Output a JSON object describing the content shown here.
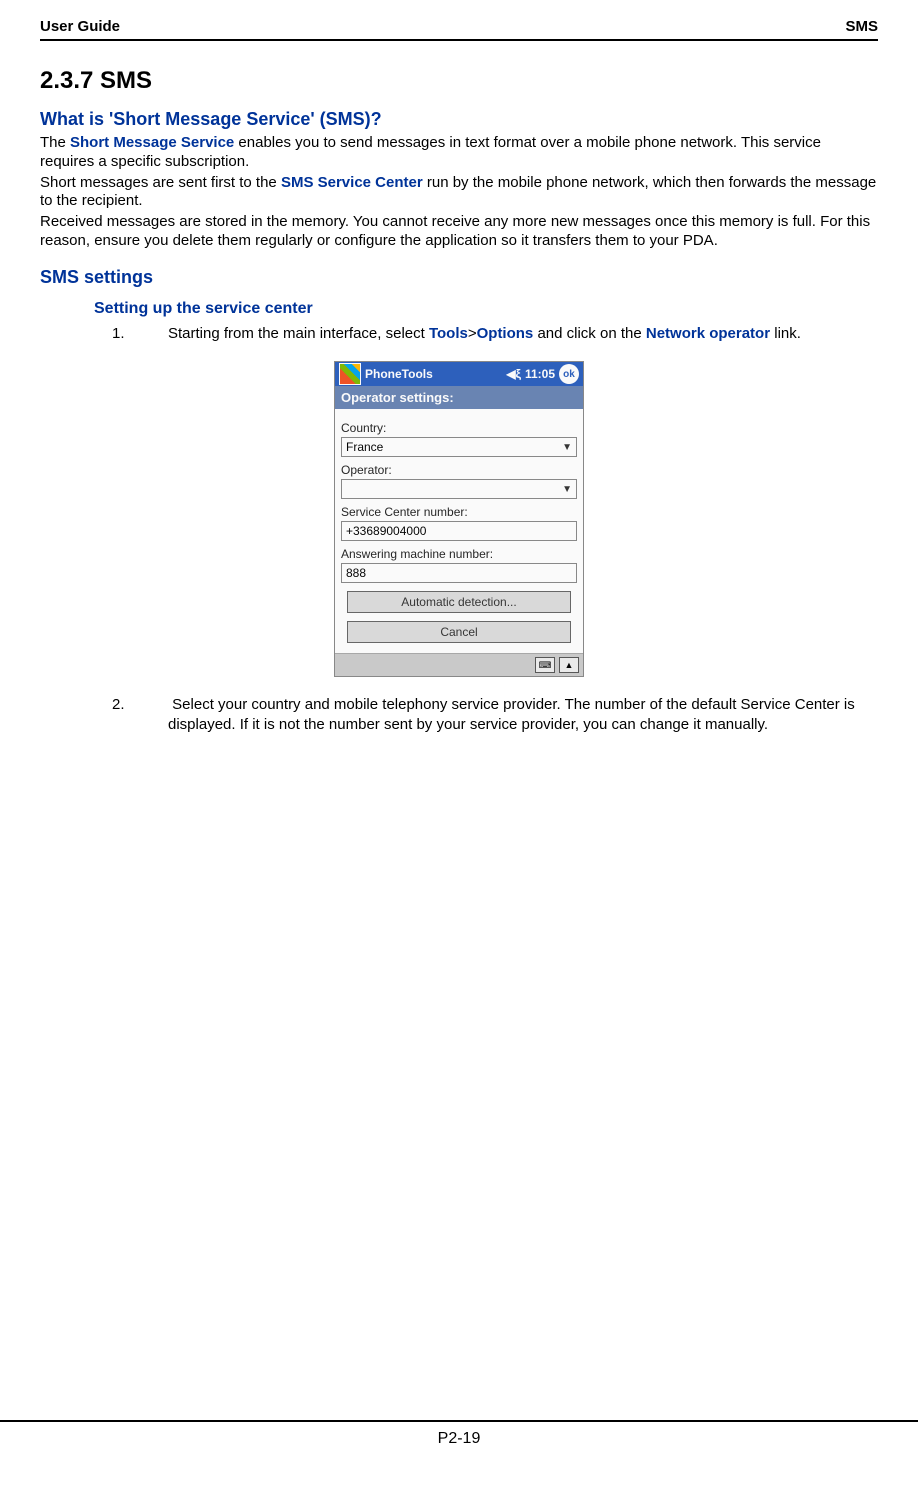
{
  "header": {
    "left": "User Guide",
    "right": "SMS"
  },
  "section_num_title": "2.3.7 SMS",
  "h2_what": "What is 'Short Message Service' (SMS)?",
  "para1_a": "The ",
  "term_sms": "Short Message Service",
  "para1_b": " enables you to send messages in text format over a mobile phone network. This service requires a specific subscription.",
  "para2_a": "Short messages are sent first to the ",
  "term_center": "SMS Service Center",
  "para2_b": " run by the mobile phone network, which then forwards the message to the recipient.",
  "para3": "Received messages are stored in the memory. You cannot receive any more new messages once this memory is full. For this reason, ensure you delete them regularly or configure the application so it transfers them to your PDA.",
  "h2_settings": "SMS settings",
  "h3_setup": "Setting up the service center",
  "step1_num": "1.",
  "step1_a": "Starting from the main interface, select ",
  "term_tools": "Tools",
  "sep": ">",
  "term_options": "Options",
  "step1_b": " and click on the ",
  "term_netop": "Network operator",
  "step1_c": " link.",
  "step2_num": "2.",
  "step2": " Select your country and mobile telephony service provider. The number of the default Service Center is displayed. If it is not the number sent by your service provider, you can change it manually.",
  "pda": {
    "app_title": "PhoneTools",
    "time": "11:05",
    "speaker_icon": "◀ξ",
    "ok": "ok",
    "subtitle": "Operator settings:",
    "lbl_country": "Country:",
    "val_country": "France",
    "lbl_operator": "Operator:",
    "val_operator": "",
    "lbl_scn": "Service Center number:",
    "val_scn": "+33689004000",
    "lbl_amn": "Answering machine number:",
    "val_amn": "888",
    "btn_auto": "Automatic detection...",
    "btn_cancel": "Cancel",
    "kb": "⌨",
    "up": "▲"
  },
  "footer": "P2-19"
}
